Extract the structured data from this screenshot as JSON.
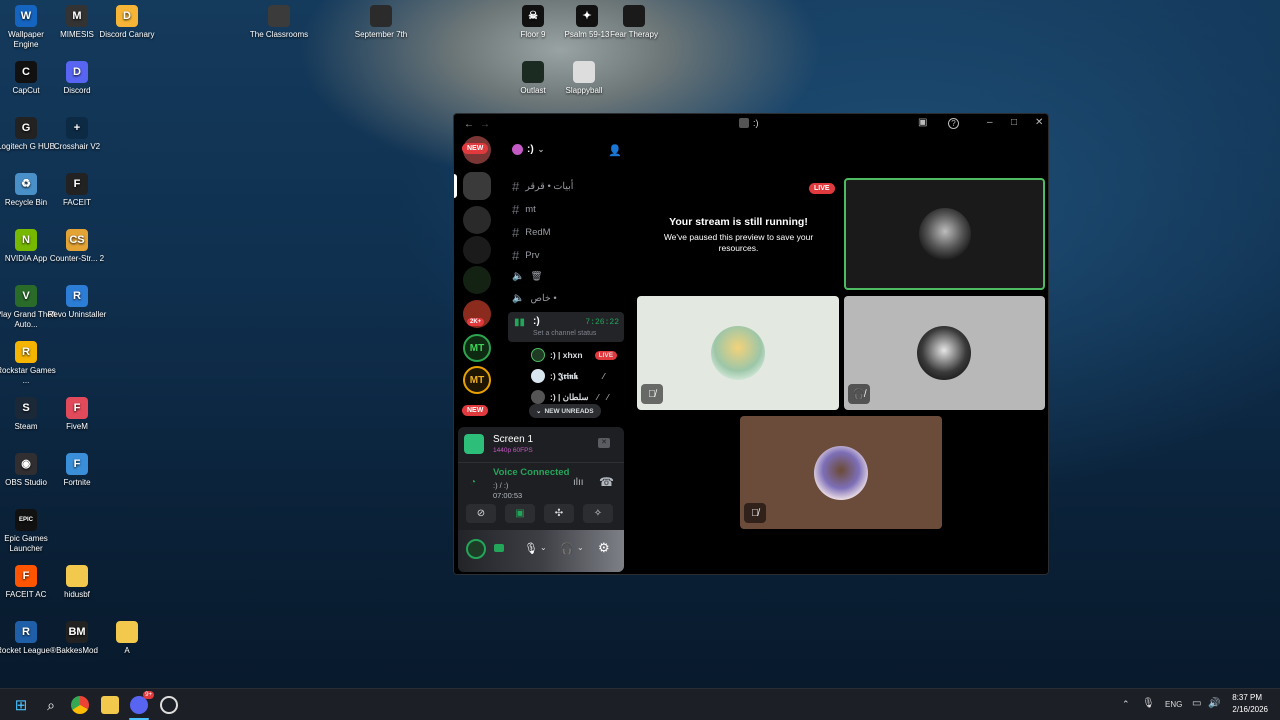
{
  "desktop": {
    "icons": [
      {
        "label": "Wallpaper Engine",
        "icon": "wallpaper-engine-icon",
        "color": "#1565c0",
        "glyph": "W"
      },
      {
        "label": "MIMESIS",
        "icon": "mimesis-icon",
        "color": "#333333",
        "glyph": "M"
      },
      {
        "label": "Discord Canary",
        "icon": "discord-canary-icon",
        "color": "#f6b536",
        "glyph": "D"
      },
      {
        "label": "CapCut",
        "icon": "capcut-icon",
        "color": "#111111",
        "glyph": "C"
      },
      {
        "label": "Discord",
        "icon": "discord-icon",
        "color": "#5865f2",
        "glyph": "D"
      },
      {
        "label": "Logitech G HUB",
        "icon": "logitech-icon",
        "color": "#222222",
        "glyph": "G"
      },
      {
        "label": "Crosshair V2",
        "icon": "crosshair-icon",
        "color": "#0d2a45",
        "glyph": "+"
      },
      {
        "label": "Recycle Bin",
        "icon": "recycle-bin-icon",
        "color": "#4a90c8",
        "glyph": "♻"
      },
      {
        "label": "FACEIT",
        "icon": "faceit-icon",
        "color": "#222222",
        "glyph": "F"
      },
      {
        "label": "NVIDIA App",
        "icon": "nvidia-icon",
        "color": "#76b900",
        "glyph": "N"
      },
      {
        "label": "Counter-Str... 2",
        "icon": "counter-strike-icon",
        "color": "#e3a335",
        "glyph": "CS"
      },
      {
        "label": "Play Grand Theft Auto...",
        "icon": "gta-icon",
        "color": "#2a6b2a",
        "glyph": "V"
      },
      {
        "label": "Revo Uninstaller",
        "icon": "revo-icon",
        "color": "#2c7dd6",
        "glyph": "R"
      },
      {
        "label": "Rockstar Games ...",
        "icon": "rockstar-icon",
        "color": "#f4b400",
        "glyph": "R"
      },
      {
        "label": "Steam",
        "icon": "steam-icon",
        "color": "#1b2838",
        "glyph": "S"
      },
      {
        "label": "FiveM",
        "icon": "fivem-icon",
        "color": "#e14a5a",
        "glyph": "F"
      },
      {
        "label": "OBS Studio",
        "icon": "obs-icon",
        "color": "#302e31",
        "glyph": "◉"
      },
      {
        "label": "Fortnite",
        "icon": "fortnite-icon",
        "color": "#3a8fd8",
        "glyph": "F"
      },
      {
        "label": "Epic Games Launcher",
        "icon": "epic-games-icon",
        "color": "#111111",
        "glyph": "EPIC"
      },
      {
        "label": "FACEIT AC",
        "icon": "faceit-ac-icon",
        "color": "#ff5500",
        "glyph": "F"
      },
      {
        "label": "hidusbf",
        "icon": "folder-icon",
        "color": "#f2c94c",
        "glyph": ""
      },
      {
        "label": "Rocket League®",
        "icon": "rocket-league-icon",
        "color": "#1f5fa8",
        "glyph": "R"
      },
      {
        "label": "BakkesMod",
        "icon": "bakkesmod-icon",
        "color": "#222222",
        "glyph": "BM"
      },
      {
        "label": "A",
        "icon": "folder-icon",
        "color": "#f2c94c",
        "glyph": ""
      },
      {
        "label": "The Classrooms",
        "icon": "classrooms-icon",
        "color": "#3b3b3b",
        "glyph": ""
      },
      {
        "label": "September 7th",
        "icon": "september-icon",
        "color": "#2b2b2b",
        "glyph": ""
      },
      {
        "label": "Floor 9",
        "icon": "floor9-icon",
        "color": "#111111",
        "glyph": "☠"
      },
      {
        "label": "Psalm 59-13",
        "icon": "psalm-icon",
        "color": "#111111",
        "glyph": "✦"
      },
      {
        "label": "Fear Therapy",
        "icon": "fear-therapy-icon",
        "color": "#1a1a1a",
        "glyph": ""
      },
      {
        "label": "Outlast",
        "icon": "outlast-icon",
        "color": "#1b2b22",
        "glyph": ""
      },
      {
        "label": "Slappyball",
        "icon": "slappyball-icon",
        "color": "#dddddd",
        "glyph": ""
      }
    ]
  },
  "window": {
    "title": ":)",
    "server_name": ":)",
    "new_pill": "NEW",
    "new_pill_bottom": "NEW",
    "badge_2k": "2K+",
    "mt_label": "MT",
    "channels": [
      {
        "name": "أبيات • قرقر",
        "type": "text"
      },
      {
        "name": "mt",
        "type": "text"
      },
      {
        "name": "RedM",
        "type": "text"
      },
      {
        "name": "Prv",
        "type": "text"
      },
      {
        "name": "🗑",
        "type": "voice"
      },
      {
        "name": "خاص •",
        "type": "voice"
      }
    ],
    "voice_channel": {
      "name": ":)",
      "timer": "7:26:22",
      "status": "Set a channel status"
    },
    "voice_users": [
      {
        "name": ":) | xhxn",
        "live": "LIVE"
      },
      {
        "name": ":) 𝕵𝖗𝖎𝖓𝖐",
        "live": ""
      },
      {
        "name": ":) | سلطان",
        "live": ""
      }
    ],
    "new_unreads": "NEW UNREADS",
    "stream_panel": {
      "title": "Screen 1",
      "quality": "1440p 60FPS"
    },
    "voice_connected": {
      "label": "Voice Connected",
      "channel": ":) / :)",
      "time": "07:00:53"
    },
    "stage": {
      "live_badge": "LIVE",
      "paused_title": "Your stream is still running!",
      "paused_body": "We've paused this preview to save your resources."
    }
  },
  "taskbar": {
    "language": "ENG",
    "time": "8:37 PM",
    "date": "2/16/2026",
    "discord_badge": "9+"
  },
  "colors": {
    "live_red": "#e03a3e",
    "voice_green": "#23a55a",
    "speaking_ring": "#4dbb5f"
  }
}
